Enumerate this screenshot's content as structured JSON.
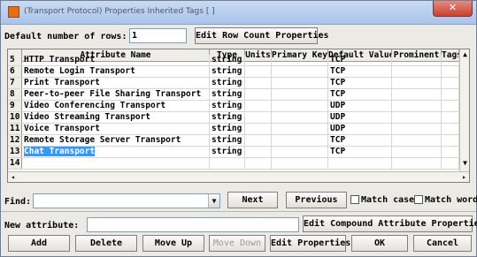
{
  "window": {
    "title": "(Transport Protocol) Properties Inherited Tags [ ]",
    "close_glyph": "✕"
  },
  "top": {
    "rows_label": "Default number of rows:",
    "rows_value": "1",
    "edit_row_count_button": "Edit Row Count Properties"
  },
  "grid": {
    "columns": [
      "Attribute Name",
      "Type",
      "Units",
      "Primary Key",
      "Default Value",
      "Prominent",
      "Tags"
    ],
    "rows": [
      {
        "num": "5",
        "name": "HTTP Transport",
        "type": "string",
        "default": "TCP"
      },
      {
        "num": "6",
        "name": "Remote Login Transport",
        "type": "string",
        "default": "TCP"
      },
      {
        "num": "7",
        "name": "Print Transport",
        "type": "string",
        "default": "TCP"
      },
      {
        "num": "8",
        "name": "Peer-to-peer File Sharing Transport",
        "type": "string",
        "default": "TCP"
      },
      {
        "num": "9",
        "name": "Video Conferencing Transport",
        "type": "string",
        "default": "UDP"
      },
      {
        "num": "10",
        "name": "Video Streaming Transport",
        "type": "string",
        "default": "UDP"
      },
      {
        "num": "11",
        "name": "Voice Transport",
        "type": "string",
        "default": "UDP"
      },
      {
        "num": "12",
        "name": "Remote Storage Server Transport",
        "type": "string",
        "default": "TCP"
      },
      {
        "num": "13",
        "name": "Chat Transport",
        "type": "string",
        "default": "TCP"
      },
      {
        "num": "14",
        "name": "",
        "type": "",
        "default": ""
      }
    ],
    "selected_row": 8
  },
  "find": {
    "label": "Find:",
    "value": "",
    "next_button": "Next",
    "previous_button": "Previous",
    "match_case_label": "Match case",
    "match_words_label": "Match words"
  },
  "new_attribute": {
    "label": "New attribute:",
    "value": "",
    "edit_compound_button": "Edit Compound Attribute Properties"
  },
  "buttons": {
    "add": "Add",
    "delete": "Delete",
    "move_up": "Move Up",
    "move_down": "Move Down",
    "edit_properties": "Edit Properties",
    "ok": "OK",
    "cancel": "Cancel"
  },
  "colors": {
    "selection": "#3399ff",
    "title_icon": "#e86d12",
    "close": "#c9412f"
  }
}
